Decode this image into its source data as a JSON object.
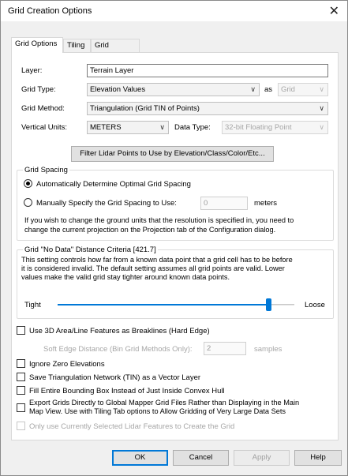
{
  "window": {
    "title": "Grid Creation Options",
    "close_glyph": "✕"
  },
  "tabs": [
    {
      "label": "Grid Options",
      "active": true
    },
    {
      "label": "Tiling",
      "active": false
    },
    {
      "label": "Grid Bounds",
      "active": false
    }
  ],
  "form": {
    "layer_label": "Layer:",
    "layer_value": "Terrain Layer",
    "grid_type_label": "Grid Type:",
    "grid_type_value": "Elevation Values",
    "as_label": "as",
    "as_value": "Grid",
    "grid_method_label": "Grid Method:",
    "grid_method_value": "Triangulation (Grid TIN of Points)",
    "vertical_units_label": "Vertical Units:",
    "vertical_units_value": "METERS",
    "data_type_label": "Data Type:",
    "data_type_value": "32-bit Floating Point",
    "filter_button": "Filter Lidar Points to Use by Elevation/Class/Color/Etc..."
  },
  "grid_spacing": {
    "title": "Grid Spacing",
    "auto_label": "Automatically Determine Optimal Grid Spacing",
    "auto_checked": true,
    "manual_label": "Manually Specify the Grid Spacing to Use:",
    "manual_checked": false,
    "manual_value": "0",
    "manual_units": "meters",
    "note_line1": "If you wish to change the ground units that the resolution is specified in, you need to",
    "note_line2": "change the current projection on the Projection tab of the Configuration dialog."
  },
  "nodata": {
    "title": "Grid \"No Data\" Distance Criteria [421.7]",
    "line1": "This setting controls how far from a known data point that a grid cell has to be before",
    "line2": "it is considered invalid. The default setting assumes all grid points are valid. Lower",
    "line3": "values make the valid grid stay tighter around known data points.",
    "tight": "Tight",
    "loose": "Loose",
    "slider_level": 0.9
  },
  "options": {
    "breaklines": "Use 3D Area/Line Features as Breaklines (Hard Edge)",
    "soft_edge_label": "Soft Edge Distance (Bin Grid Methods Only):",
    "soft_edge_value": "2",
    "soft_edge_units": "samples",
    "ignore_zero": "Ignore Zero Elevations",
    "save_tin": "Save Triangulation Network (TIN) as a Vector Layer",
    "fill_bbox": "Fill Entire Bounding Box Instead of Just Inside Convex Hull",
    "export_line1": "Export Grids Directly to Global Mapper Grid Files Rather than Displaying in the Main",
    "export_line2": "Map View. Use with Tiling Tab options to Allow Gridding of Very Large Data Sets",
    "only_selected": "Only use Currently Selected Lidar Features to Create the Grid"
  },
  "footer": {
    "ok": "OK",
    "cancel": "Cancel",
    "apply": "Apply",
    "help": "Help"
  }
}
